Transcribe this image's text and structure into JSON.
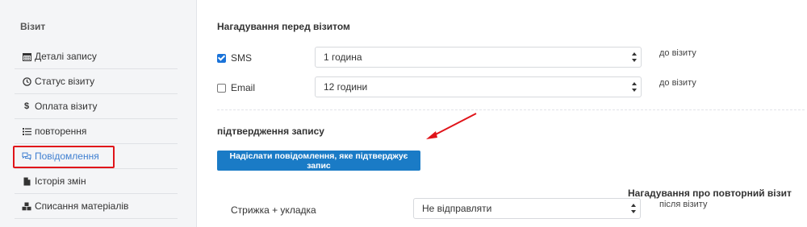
{
  "sidebar": {
    "section_title": "Візит",
    "items": [
      {
        "label": "Деталі запису",
        "icon": "calendar-icon"
      },
      {
        "label": "Статус візиту",
        "icon": "clock-icon"
      },
      {
        "label": "Оплата візиту",
        "icon": "dollar-icon"
      },
      {
        "label": "повторення",
        "icon": "list-icon"
      },
      {
        "label": "Повідомлення",
        "icon": "chat-icon"
      },
      {
        "label": "Історія змін",
        "icon": "document-icon"
      },
      {
        "label": "Списання матеріалів",
        "icon": "cubes-icon"
      }
    ],
    "active_index": 4
  },
  "reminders": {
    "title": "Нагадування перед візитом",
    "rows": [
      {
        "label": "SMS",
        "checked": true,
        "value": "1 година",
        "suffix": "до візиту"
      },
      {
        "label": "Email",
        "checked": false,
        "value": "12 години",
        "suffix": "до візиту"
      }
    ]
  },
  "confirmation": {
    "title": "підтвердження запису",
    "button_label": "Надіслати повідомлення, яке підтверджує запис"
  },
  "repeat_reminder": {
    "title": "Нагадування про повторний візит",
    "service": "Стрижка + укладка",
    "value": "Не відправляти",
    "suffix": "після візиту"
  },
  "colors": {
    "accent": "#1a7bc6",
    "highlight": "#e0141a",
    "active_link": "#3f7fd1"
  }
}
